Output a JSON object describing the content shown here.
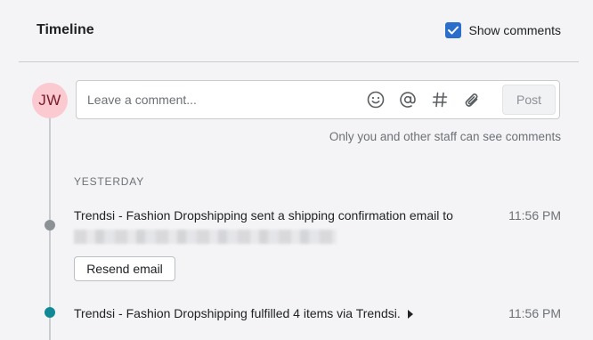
{
  "header": {
    "title": "Timeline",
    "show_comments_label": "Show comments",
    "show_comments_checked": true
  },
  "composer": {
    "avatar_initials": "JW",
    "placeholder": "Leave a comment...",
    "tools": [
      "emoji-icon",
      "mention-icon",
      "hashtag-icon",
      "attach-icon"
    ],
    "post_label": "Post",
    "note": "Only you and other staff can see comments"
  },
  "timeline": {
    "day_label": "YESTERDAY",
    "events": [
      {
        "text": "Trendsi - Fashion Dropshipping sent a shipping confirmation email to",
        "time": "11:56 PM",
        "action_label": "Resend email",
        "dot_color": "#8c9196"
      },
      {
        "text": "Trendsi - Fashion Dropshipping fulfilled 4 items via Trendsi.",
        "time": "11:56 PM",
        "dot_color": "#108896"
      }
    ]
  },
  "colors": {
    "accent": "#2c6ecb",
    "avatar_bg": "#fbc9d0"
  }
}
